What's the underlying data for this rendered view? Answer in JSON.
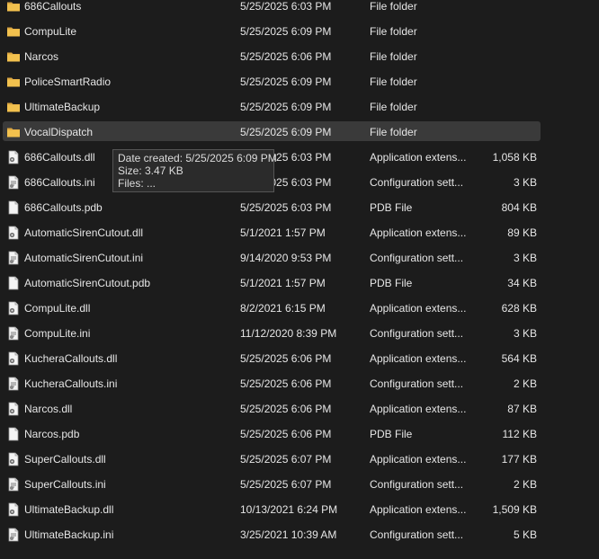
{
  "files": [
    {
      "name": "686Callouts",
      "date": "5/25/2025 6:03 PM",
      "type": "File folder",
      "size": "",
      "icon": "folder-icon"
    },
    {
      "name": "CompuLite",
      "date": "5/25/2025 6:09 PM",
      "type": "File folder",
      "size": "",
      "icon": "folder-icon"
    },
    {
      "name": "Narcos",
      "date": "5/25/2025 6:06 PM",
      "type": "File folder",
      "size": "",
      "icon": "folder-icon"
    },
    {
      "name": "PoliceSmartRadio",
      "date": "5/25/2025 6:09 PM",
      "type": "File folder",
      "size": "",
      "icon": "folder-icon"
    },
    {
      "name": "UltimateBackup",
      "date": "5/25/2025 6:09 PM",
      "type": "File folder",
      "size": "",
      "icon": "folder-icon"
    },
    {
      "name": "VocalDispatch",
      "date": "5/25/2025 6:09 PM",
      "type": "File folder",
      "size": "",
      "icon": "folder-icon",
      "hovered": true
    },
    {
      "name": "686Callouts.dll",
      "date": "5/25/2025 6:03 PM",
      "type": "Application extens...",
      "size": "1,058 KB",
      "icon": "dll-file-icon"
    },
    {
      "name": "686Callouts.ini",
      "date": "5/25/2025 6:03 PM",
      "type": "Configuration sett...",
      "size": "3 KB",
      "icon": "ini-file-icon"
    },
    {
      "name": "686Callouts.pdb",
      "date": "5/25/2025 6:03 PM",
      "type": "PDB File",
      "size": "804 KB",
      "icon": "blank-file-icon"
    },
    {
      "name": "AutomaticSirenCutout.dll",
      "date": "5/1/2021 1:57 PM",
      "type": "Application extens...",
      "size": "89 KB",
      "icon": "dll-file-icon"
    },
    {
      "name": "AutomaticSirenCutout.ini",
      "date": "9/14/2020 9:53 PM",
      "type": "Configuration sett...",
      "size": "3 KB",
      "icon": "ini-file-icon"
    },
    {
      "name": "AutomaticSirenCutout.pdb",
      "date": "5/1/2021 1:57 PM",
      "type": "PDB File",
      "size": "34 KB",
      "icon": "blank-file-icon"
    },
    {
      "name": "CompuLite.dll",
      "date": "8/2/2021 6:15 PM",
      "type": "Application extens...",
      "size": "628 KB",
      "icon": "dll-file-icon"
    },
    {
      "name": "CompuLite.ini",
      "date": "11/12/2020 8:39 PM",
      "type": "Configuration sett...",
      "size": "3 KB",
      "icon": "ini-file-icon"
    },
    {
      "name": "KucheraCallouts.dll",
      "date": "5/25/2025 6:06 PM",
      "type": "Application extens...",
      "size": "564 KB",
      "icon": "dll-file-icon"
    },
    {
      "name": "KucheraCallouts.ini",
      "date": "5/25/2025 6:06 PM",
      "type": "Configuration sett...",
      "size": "2 KB",
      "icon": "ini-file-icon"
    },
    {
      "name": "Narcos.dll",
      "date": "5/25/2025 6:06 PM",
      "type": "Application extens...",
      "size": "87 KB",
      "icon": "dll-file-icon"
    },
    {
      "name": "Narcos.pdb",
      "date": "5/25/2025 6:06 PM",
      "type": "PDB File",
      "size": "112 KB",
      "icon": "blank-file-icon"
    },
    {
      "name": "SuperCallouts.dll",
      "date": "5/25/2025 6:07 PM",
      "type": "Application extens...",
      "size": "177 KB",
      "icon": "dll-file-icon"
    },
    {
      "name": "SuperCallouts.ini",
      "date": "5/25/2025 6:07 PM",
      "type": "Configuration sett...",
      "size": "2 KB",
      "icon": "ini-file-icon"
    },
    {
      "name": "UltimateBackup.dll",
      "date": "10/13/2021 6:24 PM",
      "type": "Application extens...",
      "size": "1,509 KB",
      "icon": "dll-file-icon"
    },
    {
      "name": "UltimateBackup.ini",
      "date": "3/25/2021 10:39 AM",
      "type": "Configuration sett...",
      "size": "5 KB",
      "icon": "ini-file-icon"
    }
  ],
  "tooltip": {
    "date_created": "Date created: 5/25/2025 6:09 PM",
    "size": "Size: 3.47 KB",
    "files": "Files: ..."
  },
  "colors": {
    "background": "#1c1c1c",
    "hover_row": "#3a3a3a",
    "folder": "#f2c14e",
    "text": "#e6e6e6"
  }
}
